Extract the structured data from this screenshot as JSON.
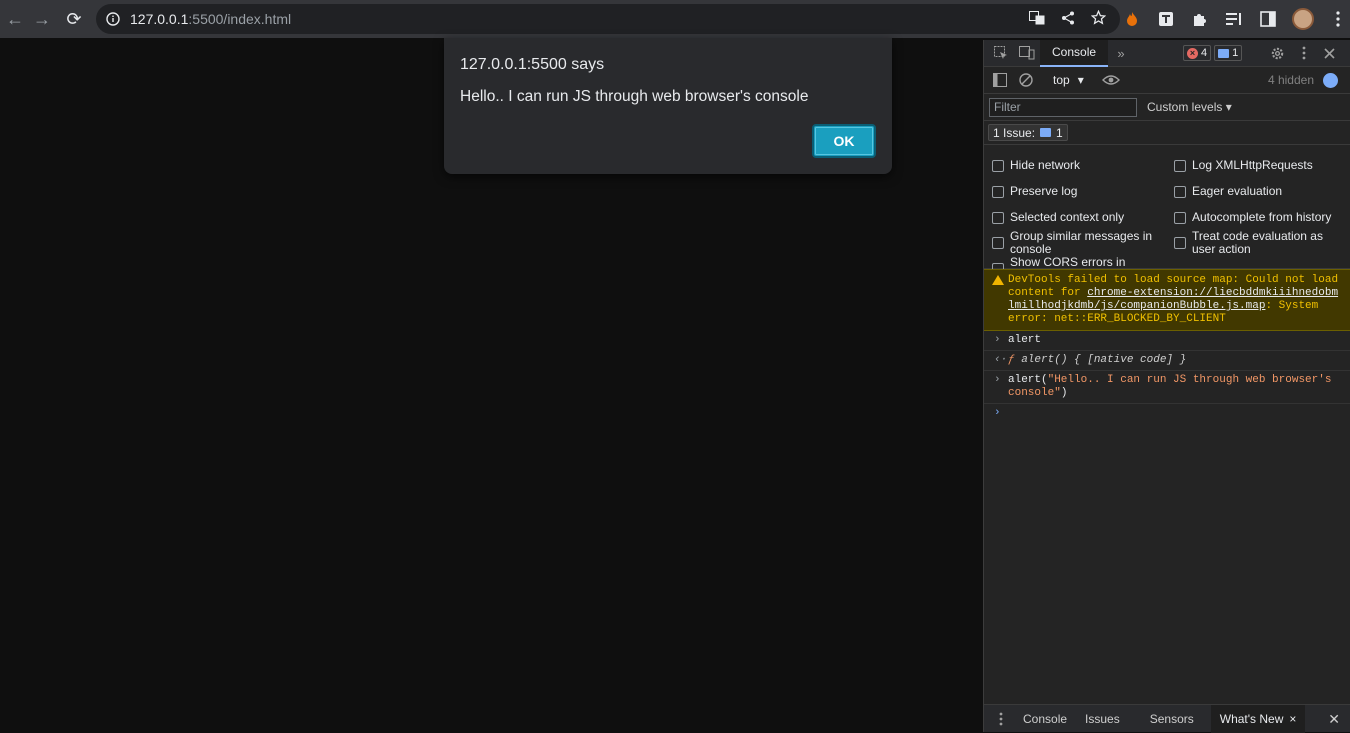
{
  "browser": {
    "back_icon": "←",
    "forward_icon": "→",
    "reload_icon": "⟳",
    "url_host": "127.0.0.1",
    "url_rest": ":5500/index.html"
  },
  "dialog": {
    "title": "127.0.0.1:5500 says",
    "message": "Hello.. I can run JS through web browser's console",
    "ok_label": "OK"
  },
  "devtools": {
    "active_tab": "Console",
    "more_tabs_icon": "»",
    "error_count": "4",
    "message_count": "1",
    "context": "top",
    "hidden_label": "4 hidden",
    "filter_placeholder": "Filter",
    "levels_label": "Custom levels ▾",
    "issues_label": "1 Issue:",
    "issues_count": "1",
    "settings": {
      "hide_network": "Hide network",
      "preserve_log": "Preserve log",
      "selected_context": "Selected context only",
      "group_similar": "Group similar messages in console",
      "show_cors": "Show CORS errors in console",
      "log_xhr": "Log XMLHttpRequests",
      "eager_eval": "Eager evaluation",
      "autocomplete": "Autocomplete from history",
      "treat_code": "Treat code evaluation as user action"
    },
    "warning": {
      "prefix": "DevTools failed to load source map: Could not load content for ",
      "link": "chrome-extension://liecbddmkiiihnedobmlmillhodjkdmb/js/companionBubble.js.map",
      "suffix": ": System error: net::ERR_BLOCKED_BY_CLIENT"
    },
    "console_lines": {
      "input1": "alert",
      "result1_kw": "ƒ",
      "result1": " alert() { [native code] }",
      "input2_fn": "alert(",
      "input2_str": "\"Hello.. I can run JS through web browser's console\"",
      "input2_end": ")"
    },
    "drawer": {
      "tabs": [
        "Console",
        "Issues",
        "Sensors",
        "What's New"
      ],
      "close_tab_icon": "×",
      "close_drawer_icon": "✕"
    }
  }
}
